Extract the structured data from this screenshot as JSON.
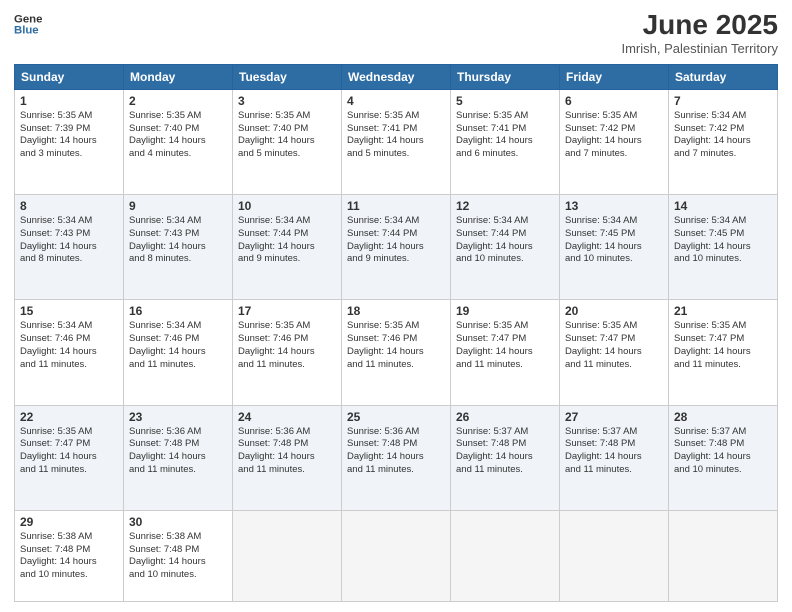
{
  "header": {
    "logo_line1": "General",
    "logo_line2": "Blue",
    "month": "June 2025",
    "location": "Imrish, Palestinian Territory"
  },
  "days_of_week": [
    "Sunday",
    "Monday",
    "Tuesday",
    "Wednesday",
    "Thursday",
    "Friday",
    "Saturday"
  ],
  "weeks": [
    [
      {
        "day": "1",
        "lines": [
          "Sunrise: 5:35 AM",
          "Sunset: 7:39 PM",
          "Daylight: 14 hours",
          "and 3 minutes."
        ]
      },
      {
        "day": "2",
        "lines": [
          "Sunrise: 5:35 AM",
          "Sunset: 7:40 PM",
          "Daylight: 14 hours",
          "and 4 minutes."
        ]
      },
      {
        "day": "3",
        "lines": [
          "Sunrise: 5:35 AM",
          "Sunset: 7:40 PM",
          "Daylight: 14 hours",
          "and 5 minutes."
        ]
      },
      {
        "day": "4",
        "lines": [
          "Sunrise: 5:35 AM",
          "Sunset: 7:41 PM",
          "Daylight: 14 hours",
          "and 5 minutes."
        ]
      },
      {
        "day": "5",
        "lines": [
          "Sunrise: 5:35 AM",
          "Sunset: 7:41 PM",
          "Daylight: 14 hours",
          "and 6 minutes."
        ]
      },
      {
        "day": "6",
        "lines": [
          "Sunrise: 5:35 AM",
          "Sunset: 7:42 PM",
          "Daylight: 14 hours",
          "and 7 minutes."
        ]
      },
      {
        "day": "7",
        "lines": [
          "Sunrise: 5:34 AM",
          "Sunset: 7:42 PM",
          "Daylight: 14 hours",
          "and 7 minutes."
        ]
      }
    ],
    [
      {
        "day": "8",
        "lines": [
          "Sunrise: 5:34 AM",
          "Sunset: 7:43 PM",
          "Daylight: 14 hours",
          "and 8 minutes."
        ]
      },
      {
        "day": "9",
        "lines": [
          "Sunrise: 5:34 AM",
          "Sunset: 7:43 PM",
          "Daylight: 14 hours",
          "and 8 minutes."
        ]
      },
      {
        "day": "10",
        "lines": [
          "Sunrise: 5:34 AM",
          "Sunset: 7:44 PM",
          "Daylight: 14 hours",
          "and 9 minutes."
        ]
      },
      {
        "day": "11",
        "lines": [
          "Sunrise: 5:34 AM",
          "Sunset: 7:44 PM",
          "Daylight: 14 hours",
          "and 9 minutes."
        ]
      },
      {
        "day": "12",
        "lines": [
          "Sunrise: 5:34 AM",
          "Sunset: 7:44 PM",
          "Daylight: 14 hours",
          "and 10 minutes."
        ]
      },
      {
        "day": "13",
        "lines": [
          "Sunrise: 5:34 AM",
          "Sunset: 7:45 PM",
          "Daylight: 14 hours",
          "and 10 minutes."
        ]
      },
      {
        "day": "14",
        "lines": [
          "Sunrise: 5:34 AM",
          "Sunset: 7:45 PM",
          "Daylight: 14 hours",
          "and 10 minutes."
        ]
      }
    ],
    [
      {
        "day": "15",
        "lines": [
          "Sunrise: 5:34 AM",
          "Sunset: 7:46 PM",
          "Daylight: 14 hours",
          "and 11 minutes."
        ]
      },
      {
        "day": "16",
        "lines": [
          "Sunrise: 5:34 AM",
          "Sunset: 7:46 PM",
          "Daylight: 14 hours",
          "and 11 minutes."
        ]
      },
      {
        "day": "17",
        "lines": [
          "Sunrise: 5:35 AM",
          "Sunset: 7:46 PM",
          "Daylight: 14 hours",
          "and 11 minutes."
        ]
      },
      {
        "day": "18",
        "lines": [
          "Sunrise: 5:35 AM",
          "Sunset: 7:46 PM",
          "Daylight: 14 hours",
          "and 11 minutes."
        ]
      },
      {
        "day": "19",
        "lines": [
          "Sunrise: 5:35 AM",
          "Sunset: 7:47 PM",
          "Daylight: 14 hours",
          "and 11 minutes."
        ]
      },
      {
        "day": "20",
        "lines": [
          "Sunrise: 5:35 AM",
          "Sunset: 7:47 PM",
          "Daylight: 14 hours",
          "and 11 minutes."
        ]
      },
      {
        "day": "21",
        "lines": [
          "Sunrise: 5:35 AM",
          "Sunset: 7:47 PM",
          "Daylight: 14 hours",
          "and 11 minutes."
        ]
      }
    ],
    [
      {
        "day": "22",
        "lines": [
          "Sunrise: 5:35 AM",
          "Sunset: 7:47 PM",
          "Daylight: 14 hours",
          "and 11 minutes."
        ]
      },
      {
        "day": "23",
        "lines": [
          "Sunrise: 5:36 AM",
          "Sunset: 7:48 PM",
          "Daylight: 14 hours",
          "and 11 minutes."
        ]
      },
      {
        "day": "24",
        "lines": [
          "Sunrise: 5:36 AM",
          "Sunset: 7:48 PM",
          "Daylight: 14 hours",
          "and 11 minutes."
        ]
      },
      {
        "day": "25",
        "lines": [
          "Sunrise: 5:36 AM",
          "Sunset: 7:48 PM",
          "Daylight: 14 hours",
          "and 11 minutes."
        ]
      },
      {
        "day": "26",
        "lines": [
          "Sunrise: 5:37 AM",
          "Sunset: 7:48 PM",
          "Daylight: 14 hours",
          "and 11 minutes."
        ]
      },
      {
        "day": "27",
        "lines": [
          "Sunrise: 5:37 AM",
          "Sunset: 7:48 PM",
          "Daylight: 14 hours",
          "and 11 minutes."
        ]
      },
      {
        "day": "28",
        "lines": [
          "Sunrise: 5:37 AM",
          "Sunset: 7:48 PM",
          "Daylight: 14 hours",
          "and 10 minutes."
        ]
      }
    ],
    [
      {
        "day": "29",
        "lines": [
          "Sunrise: 5:38 AM",
          "Sunset: 7:48 PM",
          "Daylight: 14 hours",
          "and 10 minutes."
        ]
      },
      {
        "day": "30",
        "lines": [
          "Sunrise: 5:38 AM",
          "Sunset: 7:48 PM",
          "Daylight: 14 hours",
          "and 10 minutes."
        ]
      },
      {
        "day": "",
        "lines": []
      },
      {
        "day": "",
        "lines": []
      },
      {
        "day": "",
        "lines": []
      },
      {
        "day": "",
        "lines": []
      },
      {
        "day": "",
        "lines": []
      }
    ]
  ]
}
